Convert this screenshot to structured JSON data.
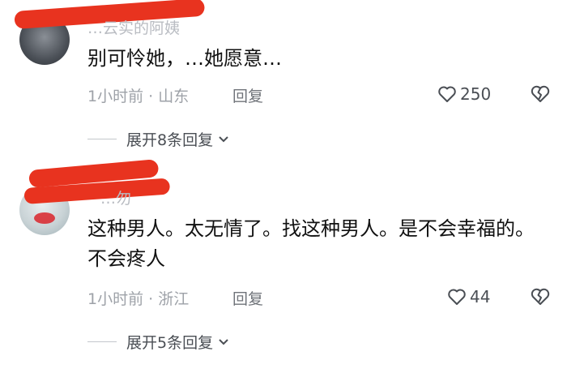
{
  "comments": [
    {
      "username": "…云实的阿姨",
      "text": "别可怜她，…她愿意…",
      "time": "1小时前",
      "sep": "·",
      "location": "山东",
      "reply_label": "回复",
      "likes": "250",
      "expand_label": "展开8条回复"
    },
    {
      "username": "…勿",
      "text": "这种男人。太无情了。找这种男人。是不会幸福的。不会疼人",
      "time": "1小时前",
      "sep": "·",
      "location": "浙江",
      "reply_label": "回复",
      "likes": "44",
      "expand_label": "展开5条回复"
    }
  ],
  "colors": {
    "redaction": "#e8331f",
    "muted": "#9ea2a8",
    "text": "#111111"
  },
  "icons": [
    "heart-icon",
    "broken-heart-icon",
    "chevron-down-icon"
  ]
}
